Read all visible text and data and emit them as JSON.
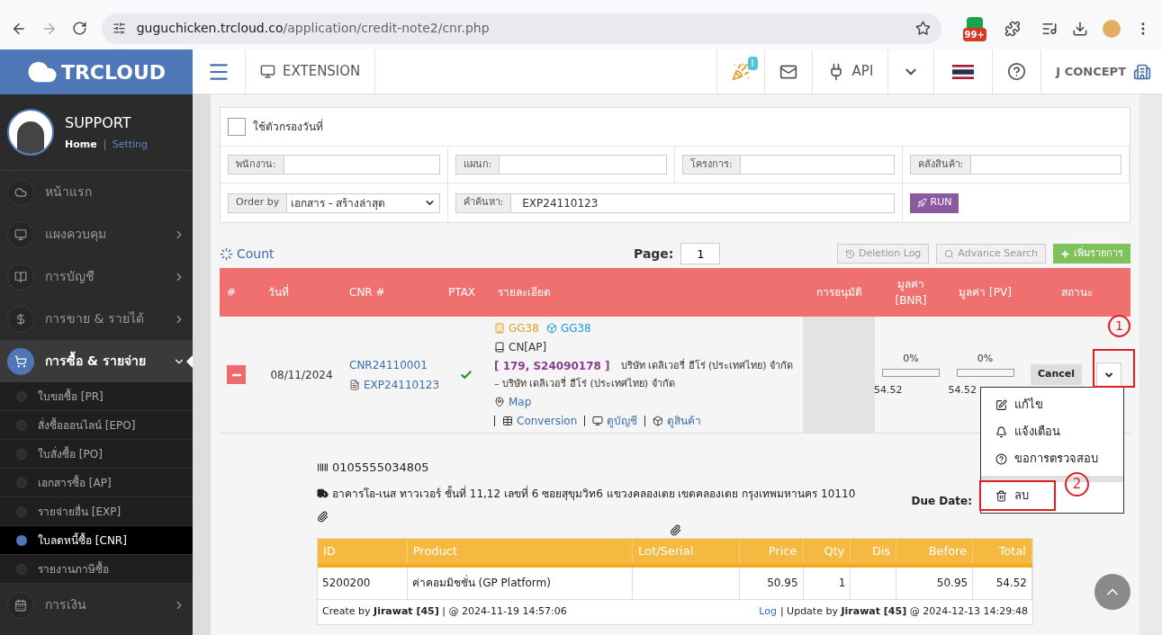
{
  "browser": {
    "url_host": "guguchicken.trcloud.co",
    "url_path": "/application/credit-note2/cnr.php",
    "extension_badge": "99+"
  },
  "header": {
    "logo": "TRCLOUD",
    "extension": "EXTENSION",
    "notification_badge": "I",
    "api": "API",
    "company": "J CONCEPT"
  },
  "sidebar": {
    "user": "SUPPORT",
    "home": "Home",
    "setting": "Setting",
    "items": [
      {
        "label": "หน้าแรก",
        "kind": "link"
      },
      {
        "label": "แผงควบคุม",
        "kind": "group",
        "expanded": false
      },
      {
        "label": "การบัญชี",
        "kind": "group",
        "expanded": false
      },
      {
        "label": "การขาย & รายได้",
        "kind": "group",
        "expanded": false
      },
      {
        "label": "การซื้อ & รายจ่าย",
        "kind": "group",
        "expanded": true,
        "children": [
          {
            "label": "ใบขอซื้อ [PR]",
            "selected": false
          },
          {
            "label": "สั่งซื้อออนไลน์ [EPO]",
            "selected": false
          },
          {
            "label": "ใบสั่งซื้อ [PO]",
            "selected": false
          },
          {
            "label": "เอกสารซื้อ [AP]",
            "selected": false
          },
          {
            "label": "รายจ่ายอื่น [EXP]",
            "selected": false
          },
          {
            "label": "ใบลดหนี้ซื้อ [CNR]",
            "selected": true
          },
          {
            "label": "รายงานภาษีซื้อ",
            "selected": false
          }
        ]
      },
      {
        "label": "การเงิน",
        "kind": "group",
        "expanded": false
      }
    ]
  },
  "filters": {
    "date_filter": {
      "label": "ใช้ตัวกรองวันที่",
      "checked": false
    },
    "fields": [
      {
        "label": "พนักงาน:"
      },
      {
        "label": "แผนก:"
      },
      {
        "label": "โครงการ:"
      },
      {
        "label": "คลังสินค้า:"
      }
    ],
    "order_by": {
      "label": "Order by",
      "value": "เอกสาร - สร้างล่าสุด"
    },
    "search": {
      "label": "คำค้นหา:",
      "value": "EXP24110123"
    },
    "run": "RUN"
  },
  "toolbar": {
    "count": "Count",
    "page_label": "Page:",
    "page": "1",
    "deletion_log": "Deletion Log",
    "advance_search": "Advance Search",
    "add": "เพิ่มรายการ"
  },
  "table": {
    "columns": [
      "#",
      "วันที่",
      "CNR #",
      "PTAX",
      "รายละเอียด",
      "การอนุมัติ",
      "มูลค่า [BNR]",
      "มูลค่า [PV]",
      "สถานะ"
    ],
    "rows": [
      {
        "expanded": true,
        "date": "08/11/2024",
        "cnr": "CNR24110001",
        "reference": "EXP24110123",
        "ptax": true,
        "branch": "GG38",
        "warehouse": "GG38",
        "doc_type": "CN[AP]",
        "refs": "[ 179, S24090178 ]",
        "company": "บริษัท เดลิเวอรี่ ฮีโร่ (ประเทศไทย) จำกัด",
        "company_line2": "– บริษัท เดลิเวอรี่ ฮีโร่ (ประเทศไทย) จำกัด",
        "map": "Map",
        "links": [
          "Conversion",
          "ดูบัญชี",
          "ดูสินค้า"
        ],
        "bnr": {
          "percent": "0%",
          "level": 0,
          "value": "54.52"
        },
        "pv": {
          "percent": "0%",
          "level": 0,
          "value": "54.52"
        },
        "status": "Cancel"
      }
    ]
  },
  "detail": {
    "tax_id": "0105555034805",
    "address": "อาคารโอ-เนส ทาวเวอร์ ชั้นที่ 11,12 เลขที่ 6 ซอยสุขุมวิท6 แขวงคลองเตย เขตคลองเตย กรุงเทพมหานคร 10110",
    "due_label": "Due Date:",
    "items": {
      "columns": [
        "ID",
        "Product",
        "Lot/Serial",
        "Price",
        "Qty",
        "Dis",
        "Before",
        "Total"
      ],
      "rows": [
        [
          "5200200",
          "ค่าคอมมิชชั่น (GP Platform)",
          "",
          "50.95",
          "1",
          "",
          "50.95",
          "54.52"
        ]
      ]
    },
    "created": "Create by **Jirawat [45]** | @ 2024-11-19 14:57:06",
    "log": "Log",
    "updated": "| Update by **Jirawat [45]** @ 2024-12-13 14:29:48"
  },
  "menu": {
    "items": [
      {
        "label": "แก้ไข",
        "kind": "edit"
      },
      {
        "label": "แจ้งเตือน",
        "kind": "alert"
      },
      {
        "label": "ขอการตรวจสอบ",
        "kind": "help"
      },
      {
        "label": "ลบ",
        "kind": "delete"
      }
    ]
  },
  "annotations": [
    {
      "label": "1"
    },
    {
      "label": "2"
    }
  ]
}
